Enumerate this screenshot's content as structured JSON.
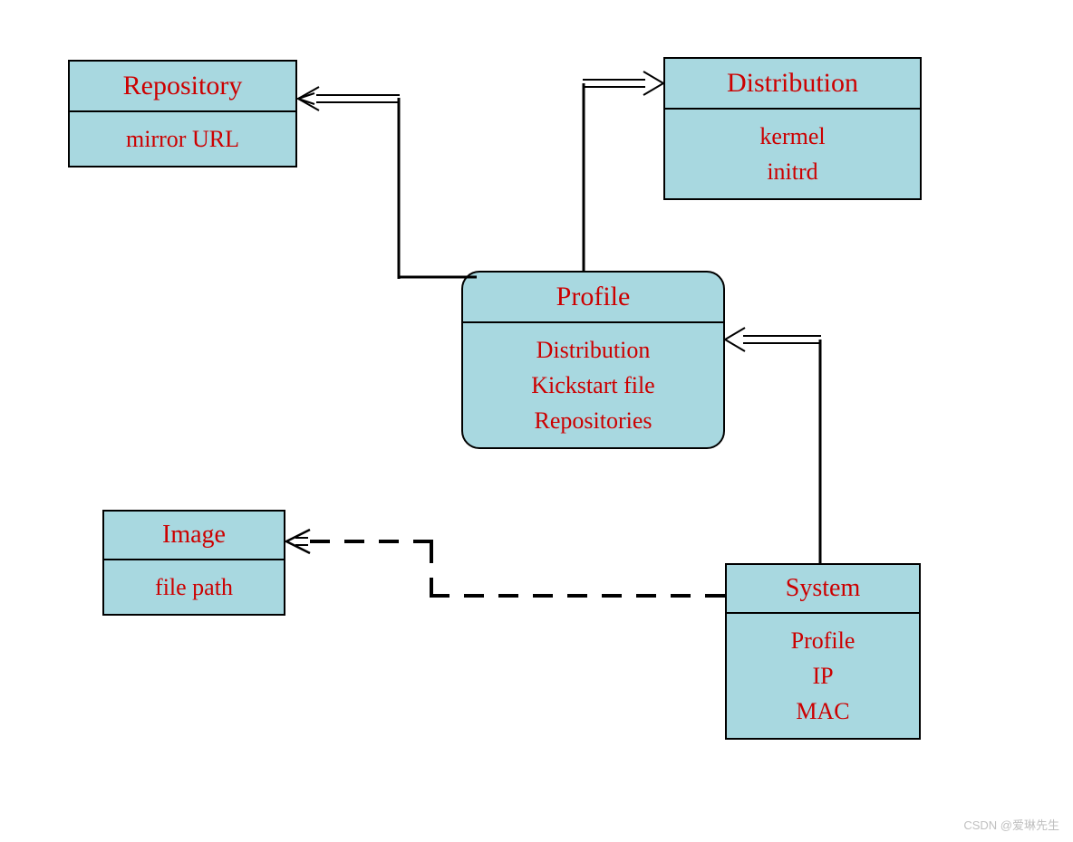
{
  "boxes": {
    "repository": {
      "title": "Repository",
      "body": "mirror URL"
    },
    "distribution": {
      "title": "Distribution",
      "body_line1": "kermel",
      "body_line2": "initrd"
    },
    "profile": {
      "title": "Profile",
      "body_line1": "Distribution",
      "body_line2": "Kickstart file",
      "body_line3": "Repositories"
    },
    "image": {
      "title": "Image",
      "body": "file path"
    },
    "system": {
      "title": "System",
      "body_line1": "Profile",
      "body_line2": "IP",
      "body_line3": "MAC"
    }
  },
  "watermark": "CSDN @爱琳先生"
}
